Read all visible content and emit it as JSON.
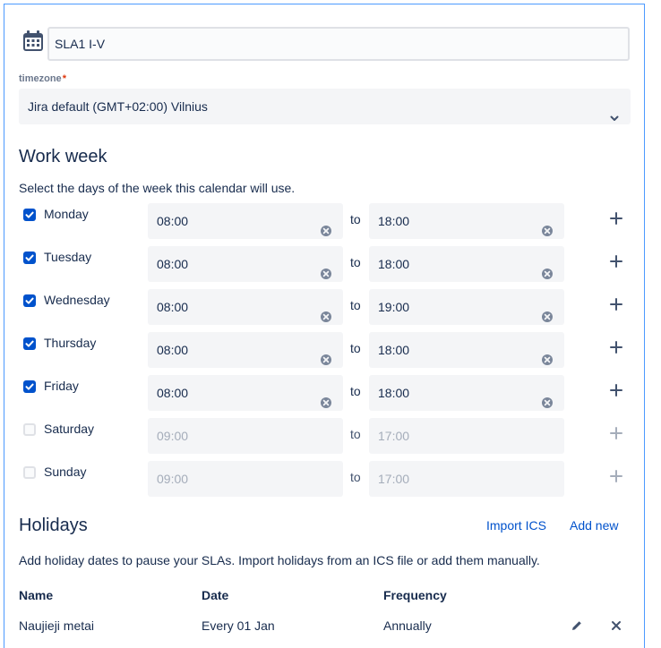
{
  "calendar": {
    "name": "SLA1 I-V",
    "timezone_label": "timezone",
    "timezone_required": "*",
    "timezone_value": "Jira default (GMT+02:00) Vilnius"
  },
  "work_week": {
    "title": "Work week",
    "description": "Select the days of the week this calendar will use.",
    "to_label": "to",
    "days": [
      {
        "label": "Monday",
        "checked": true,
        "start": "08:00",
        "end": "18:00"
      },
      {
        "label": "Tuesday",
        "checked": true,
        "start": "08:00",
        "end": "18:00"
      },
      {
        "label": "Wednesday",
        "checked": true,
        "start": "08:00",
        "end": "19:00"
      },
      {
        "label": "Thursday",
        "checked": true,
        "start": "08:00",
        "end": "18:00"
      },
      {
        "label": "Friday",
        "checked": true,
        "start": "08:00",
        "end": "18:00"
      },
      {
        "label": "Saturday",
        "checked": false,
        "start": "09:00",
        "end": "17:00"
      },
      {
        "label": "Sunday",
        "checked": false,
        "start": "09:00",
        "end": "17:00"
      }
    ]
  },
  "holidays": {
    "title": "Holidays",
    "import_label": "Import ICS",
    "add_label": "Add new",
    "description": "Add holiday dates to pause your SLAs. Import holidays from an ICS file or add them manually.",
    "columns": [
      "Name",
      "Date",
      "Frequency"
    ],
    "rows": [
      {
        "name": "Naujieji metai",
        "date": "Every 01 Jan",
        "frequency": "Annually"
      }
    ]
  },
  "colors": {
    "accent": "#0052cc",
    "border_focus": "#4c9aff",
    "field_bg": "#f4f5f7",
    "text": "#172b4d"
  },
  "icons": [
    "calendar-icon",
    "chevron-down-icon",
    "checkbox-check-icon",
    "clear-icon",
    "plus-icon",
    "edit-pencil-icon",
    "close-icon"
  ]
}
